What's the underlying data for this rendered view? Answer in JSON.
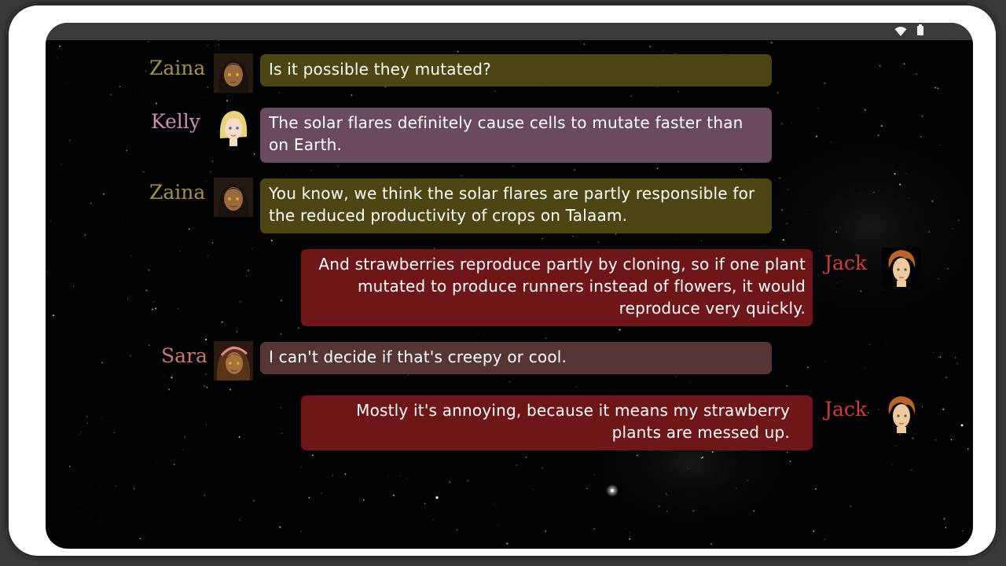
{
  "status_bar": {
    "wifi_icon": "wifi-icon",
    "battery_icon": "battery-icon"
  },
  "colors": {
    "zaina_bubble": "#4d4513",
    "kelly_bubble": "#6a4a5e",
    "jack_bubble": "#6e1618",
    "sara_bubble": "#553634",
    "zaina_name": "#a2934a",
    "kelly_name": "#cb8fb4",
    "jack_name": "#d43a36",
    "sara_name": "#c77a75"
  },
  "messages": [
    {
      "speaker": "Zaina",
      "text": "Is it possible they mutated?"
    },
    {
      "speaker": "Kelly",
      "text": "The solar flares definitely cause cells to mutate faster than on Earth."
    },
    {
      "speaker": "Zaina",
      "text": "You know, we think the solar flares are partly responsible for the reduced productivity of crops on Talaam."
    },
    {
      "speaker": "Jack",
      "text": "And strawberries reproduce partly by cloning, so if one plant mutated to produce runners instead of flowers, it would reproduce very quickly."
    },
    {
      "speaker": "Sara",
      "text": "I can't decide if that's creepy or cool."
    },
    {
      "speaker": "Jack",
      "text": "Mostly it's annoying, because it means my strawberry plants are messed up."
    }
  ]
}
